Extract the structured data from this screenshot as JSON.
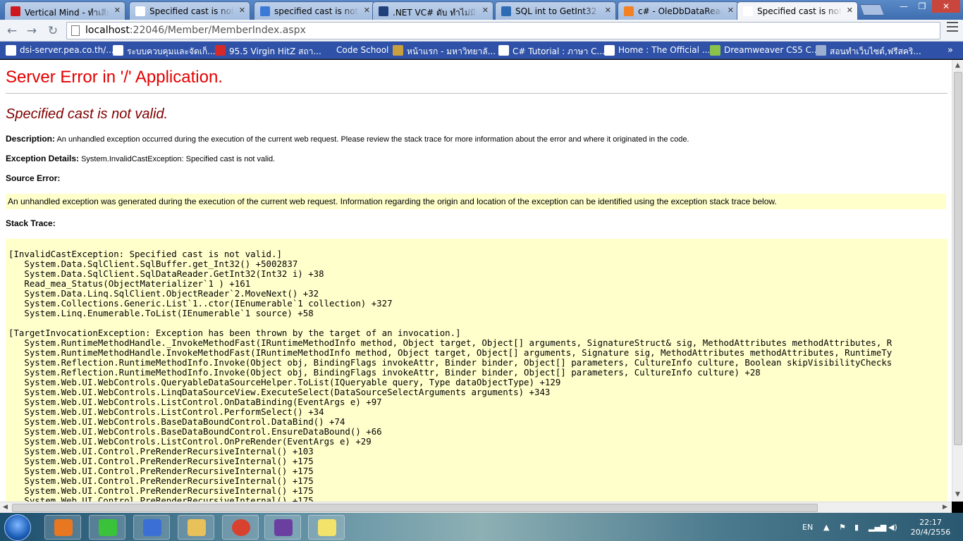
{
  "browser": {
    "tabs": [
      {
        "title": "Vertical Mind - ทำเสีย",
        "favicon_color": "#cc181e"
      },
      {
        "title": "Specified cast is not va",
        "favicon_color": "#ffffff"
      },
      {
        "title": "specified cast is not va",
        "favicon_color": "#3a79d6"
      },
      {
        "title": ".NET VC# ดับ ทำไม่มีร",
        "favicon_color": "#1f3f7a"
      },
      {
        "title": "SQL int to GetInt32 to",
        "favicon_color": "#2d6bb3"
      },
      {
        "title": "c# - OleDbDataReader",
        "favicon_color": "#f48024"
      },
      {
        "title": "Specified cast is not va",
        "favicon_color": "#ffffff"
      }
    ],
    "active_tab_index": 6,
    "window_controls": {
      "minimize": "—",
      "restore": "❐",
      "close": "✕"
    },
    "address": {
      "host": "localhost",
      "path": ":22046/Member/MemberIndex.aspx"
    },
    "bookmarks": [
      {
        "label": "dsi-server.pea.co.th/...",
        "icon_color": "#ffffff"
      },
      {
        "label": "ระบบควบคุมและจัดเก็...",
        "icon_color": "#ffffff"
      },
      {
        "label": "95.5 Virgin HitZ สถา...",
        "icon_color": "#d42a2a"
      },
      {
        "label": "Code School",
        "icon_color": "#2f52a8"
      },
      {
        "label": "หน้าแรก - มหาวิทยาลั...",
        "icon_color": "#c8a040"
      },
      {
        "label": "C# Tutorial : ภาษา C...",
        "icon_color": "#ffffff"
      },
      {
        "label": "Home : The Official ...",
        "icon_color": "#ffffff"
      },
      {
        "label": "Dreamweaver CS5 C...",
        "icon_color": "#8bc34a"
      },
      {
        "label": "สอนทำเว็บไซต์,ฟรีสคริ...",
        "icon_color": "#9bb0d0"
      }
    ],
    "bookmarks_overflow": "»"
  },
  "error_page": {
    "title": "Server Error in '/' Application.",
    "subtitle": "Specified cast is not valid.",
    "description_label": "Description:",
    "description_text": "An unhandled exception occurred during the execution of the current web request. Please review the stack trace for more information about the error and where it originated in the code.",
    "exception_label": "Exception Details:",
    "exception_text": "System.InvalidCastException: Specified cast is not valid.",
    "source_error_label": "Source Error:",
    "source_error_text": "An unhandled exception was generated during the execution of the current web request. Information regarding the origin and location of the exception can be identified using the exception stack trace below.",
    "stack_trace_label": "Stack Trace:",
    "stack_trace": [
      "[InvalidCastException: Specified cast is not valid.]",
      "   System.Data.SqlClient.SqlBuffer.get_Int32() +5002837",
      "   System.Data.SqlClient.SqlDataReader.GetInt32(Int32 i) +38",
      "   Read_mea_Status(ObjectMaterializer`1 ) +161",
      "   System.Data.Linq.SqlClient.ObjectReader`2.MoveNext() +32",
      "   System.Collections.Generic.List`1..ctor(IEnumerable`1 collection) +327",
      "   System.Linq.Enumerable.ToList(IEnumerable`1 source) +58",
      "",
      "[TargetInvocationException: Exception has been thrown by the target of an invocation.]",
      "   System.RuntimeMethodHandle._InvokeMethodFast(IRuntimeMethodInfo method, Object target, Object[] arguments, SignatureStruct& sig, MethodAttributes methodAttributes, R",
      "   System.RuntimeMethodHandle.InvokeMethodFast(IRuntimeMethodInfo method, Object target, Object[] arguments, Signature sig, MethodAttributes methodAttributes, RuntimeTy",
      "   System.Reflection.RuntimeMethodInfo.Invoke(Object obj, BindingFlags invokeAttr, Binder binder, Object[] parameters, CultureInfo culture, Boolean skipVisibilityChecks",
      "   System.Reflection.RuntimeMethodInfo.Invoke(Object obj, BindingFlags invokeAttr, Binder binder, Object[] parameters, CultureInfo culture) +28",
      "   System.Web.UI.WebControls.QueryableDataSourceHelper.ToList(IQueryable query, Type dataObjectType) +129",
      "   System.Web.UI.WebControls.LinqDataSourceView.ExecuteSelect(DataSourceSelectArguments arguments) +343",
      "   System.Web.UI.WebControls.ListControl.OnDataBinding(EventArgs e) +97",
      "   System.Web.UI.WebControls.ListControl.PerformSelect() +34",
      "   System.Web.UI.WebControls.BaseDataBoundControl.DataBind() +74",
      "   System.Web.UI.WebControls.BaseDataBoundControl.EnsureDataBound() +66",
      "   System.Web.UI.WebControls.ListControl.OnPreRender(EventArgs e) +29",
      "   System.Web.UI.Control.PreRenderRecursiveInternal() +103",
      "   System.Web.UI.Control.PreRenderRecursiveInternal() +175",
      "   System.Web.UI.Control.PreRenderRecursiveInternal() +175",
      "   System.Web.UI.Control.PreRenderRecursiveInternal() +175",
      "   System.Web.UI.Control.PreRenderRecursiveInternal() +175",
      "   System.Web.UI.Control.PreRenderRecursiveInternal() +175"
    ]
  },
  "taskbar": {
    "apps": [
      {
        "name": "media-player",
        "color": "#e87722"
      },
      {
        "name": "line",
        "color": "#3ac33a"
      },
      {
        "name": "messenger",
        "color": "#3b6fd6"
      },
      {
        "name": "file-explorer",
        "color": "#e8c15a"
      },
      {
        "name": "chrome",
        "color": "#d9412f"
      },
      {
        "name": "visual-studio",
        "color": "#6a3fa0"
      },
      {
        "name": "sticky-notes",
        "color": "#f4e36a"
      }
    ],
    "language": "EN",
    "time": "22:17",
    "date": "20/4/2556"
  }
}
